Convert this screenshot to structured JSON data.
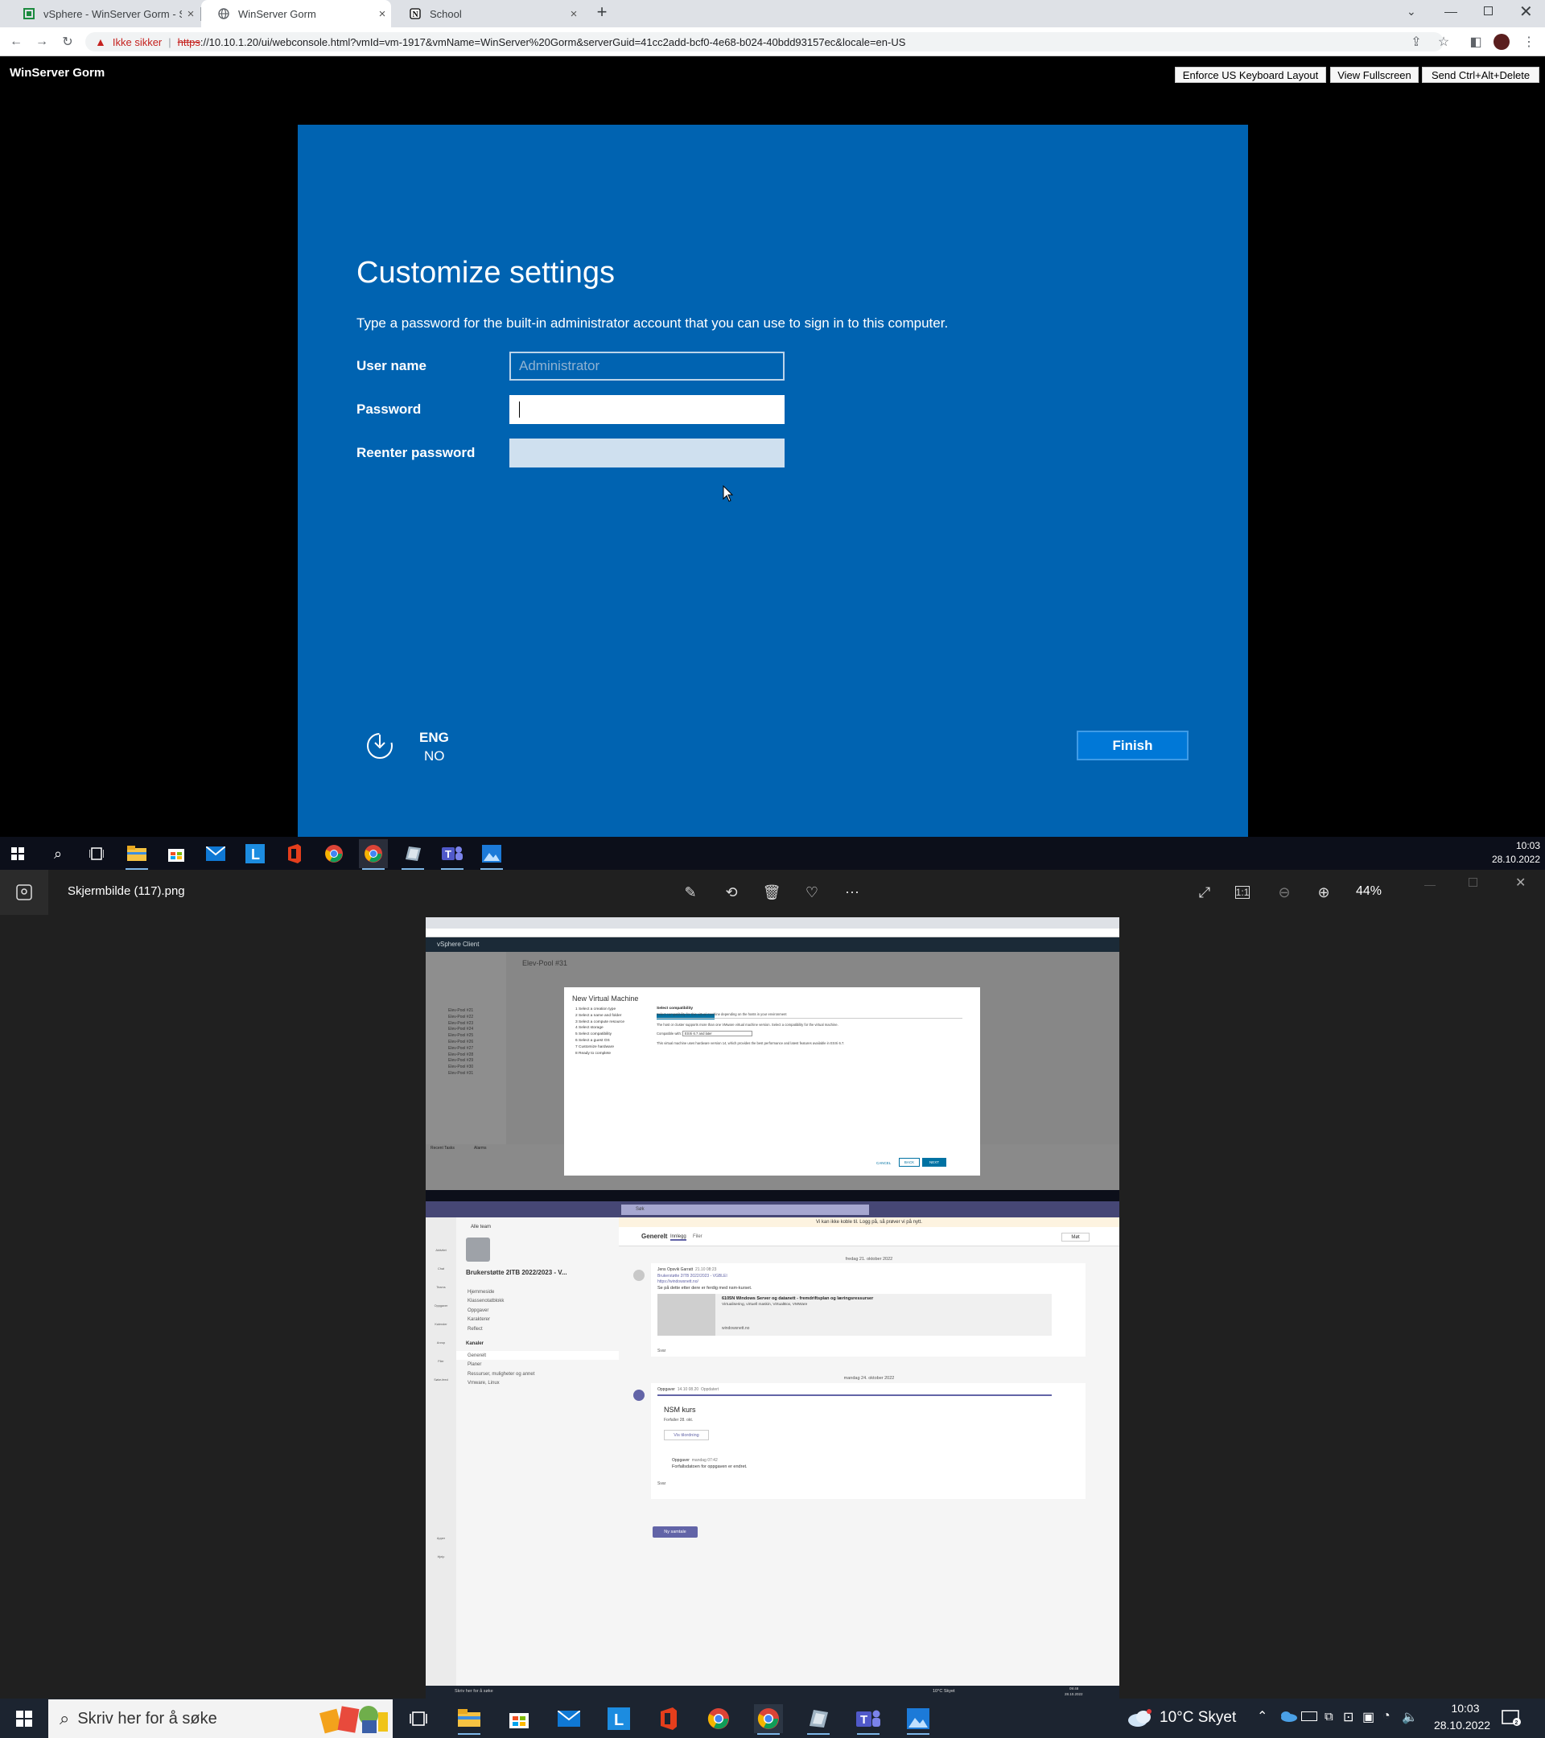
{
  "browser": {
    "tabs": [
      {
        "title": "vSphere - WinServer Gorm - Sum",
        "close": "×"
      },
      {
        "title": "WinServer Gorm",
        "close": "×"
      },
      {
        "title": "School",
        "close": "×"
      }
    ],
    "new_tab": "+",
    "security_label": "Ikke sikker",
    "url_scheme": "https",
    "url_rest": "://10.10.1.20/ui/webconsole.html?vmId=vm-1917&vmName=WinServer%20Gorm&serverGuid=41cc2add-bcf0-4e68-b024-40bdd93157ec&locale=en-US"
  },
  "console": {
    "vm_name": "WinServer Gorm",
    "buttons": {
      "keyboard": "Enforce US Keyboard Layout",
      "fullscreen": "View Fullscreen",
      "cad": "Send Ctrl+Alt+Delete"
    }
  },
  "setup": {
    "title": "Customize settings",
    "description": "Type a password for the built-in administrator account that you can use to sign in to this computer.",
    "username_label": "User name",
    "username_placeholder": "Administrator",
    "password_label": "Password",
    "reenter_label": "Reenter password",
    "lang_primary": "ENG",
    "lang_secondary": "NO",
    "finish": "Finish"
  },
  "inner_taskbar": {
    "time": "10:03",
    "date": "28.10.2022"
  },
  "photos": {
    "filename": "Skjermbilde (117).png",
    "zoom": "44%"
  },
  "thumbnail": {
    "vsphere": {
      "app": "vSphere Client",
      "pool": "Elev-Pool #31",
      "dialog_title": "New Virtual Machine",
      "steps": [
        "1 Select a creation type",
        "2 Select a name and folder",
        "3 Select a compute resource",
        "4 Select storage",
        "5 Select compatibility",
        "6 Select a guest OS",
        "7 Customize hardware",
        "8 Ready to complete"
      ],
      "section": "Select compatibility",
      "section_desc": "Select compatibility for this virtual machine depending on the hosts in your environment",
      "info": "The host or cluster supports more than one VMware virtual machine version. Select a compatibility for the virtual machine.",
      "compat_label": "Compatible with:",
      "compat_value": "ESXi 6.7 and later",
      "hw_info": "This virtual machine uses hardware version 14, which provides the best performance and latest features available in ESXi 6.7.",
      "cancel": "CANCEL",
      "back": "BACK",
      "next": "NEXT",
      "recent_tasks": "Recent Tasks",
      "alarms": "Alarms",
      "tree": [
        "Elev-Pool #21",
        "Elev-Pool #22",
        "Elev-Pool #23",
        "Elev-Pool #24",
        "Elev-Pool #25",
        "Elev-Pool #26",
        "Elev-Pool #27",
        "Elev-Pool #28",
        "Elev-Pool #29",
        "Elev-Pool #30",
        "Elev-Pool #31"
      ]
    },
    "teams": {
      "search": "Søk",
      "banner": "Vi kan ikke koble til. Logg på, så prøver vi på nytt.",
      "banner_link": "Logg på",
      "back": "Alle team",
      "team_name": "Brukerstøtte 2ITB 2022/2023 - V...",
      "team_links": [
        "Hjemmeside",
        "Klassenotatblokk",
        "Oppgaver",
        "Karakterer",
        "Reflect"
      ],
      "channels_header": "Kanaler",
      "channels": [
        "Generelt",
        "Planer",
        "Ressurser, muligheter og annet",
        "Vmware, Linux"
      ],
      "channel": "Generelt",
      "tab_posts": "Innlegg",
      "tab_files": "Filer",
      "meet": "Møt",
      "reply": "Svar",
      "date1": "fredag 21. oktober 2022",
      "post1_author": "Jens Opsvik Garratt",
      "post1_time": "21.10 08:23",
      "post1_team": "Brukerstøtte 2ITB 2022/2023 - VGBLEI",
      "post1_link": "https://windowsnett.no/",
      "post1_text": "Se på dette etter dere er ferdig med nsm-kurset.",
      "card_title": "6105N Windows Server og datanett - fremdriftsplan og læringsressurser",
      "card_sub": "Virtualisering, virtuell maskin, VirtualBox, VMWare",
      "card_domain": "windowsnett.no",
      "date2": "mandag 24. oktober 2022",
      "post2_author": "Oppgaver",
      "post2_time": "14.10 08.20",
      "post2_status": "Oppdatert",
      "task_title": "NSM kurs",
      "task_due": "Forfaller 28. okt.",
      "task_btn": "Vis tilordning",
      "post3_author": "Oppgaver",
      "post3_time": "mandag 07:42",
      "post3_text": "Forfallsdatoen for oppgaven er endret.",
      "new_conv": "Ny samtale",
      "rail": [
        "Aktivitet",
        "Chat",
        "Teams",
        "Oppgaver",
        "Kalender",
        "Anrop",
        "Filer",
        "Søke-feed"
      ],
      "apps": "Apper",
      "help": "Hjelp"
    },
    "taskbar": {
      "search": "Skriv her for å søke",
      "weather": "10°C Skyet",
      "time": "09:48",
      "date": "28.10.2022"
    }
  },
  "outer_taskbar": {
    "search_placeholder": "Skriv her for å søke",
    "weather": "10°C Skyet",
    "time": "10:03",
    "date": "28.10.2022"
  },
  "colors": {
    "setup_blue": "#0063b1",
    "finish_blue": "#0078d7",
    "teams_purple": "#6264a7",
    "vsphere_dark": "#1b2a37",
    "chrome_frame": "#dee1e6"
  }
}
